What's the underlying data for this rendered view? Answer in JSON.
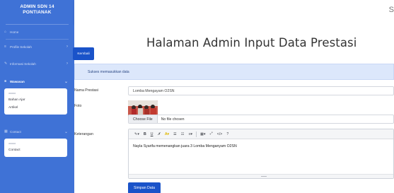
{
  "sidebar": {
    "brand_line1": "ADMIN SDN 14",
    "brand_line2": "PONTIANAK",
    "items": [
      {
        "label": "Home",
        "icon": "home-icon"
      },
      {
        "label": "Profile Sekolah",
        "icon": "list-icon"
      },
      {
        "label": "Informasi Sekolah",
        "icon": "wrench-icon"
      },
      {
        "label": "Wawasan",
        "icon": "folder-icon"
      },
      {
        "label": "Contact",
        "icon": "table-icon"
      }
    ],
    "wawasan_sub": {
      "heading": "aaaaa",
      "items": [
        "Bahan Ajar",
        "Artikel"
      ]
    },
    "contact_sub": {
      "heading": "aaaaa",
      "items": [
        "Contact"
      ]
    }
  },
  "topbar": {
    "user_initial": "S"
  },
  "main": {
    "title": "Halaman Admin Input Data Prestasi",
    "back_label": "Kembali",
    "alert_text": "Sukses memasukkan data",
    "fields": {
      "nama_label": "Nama Prestasi",
      "nama_value": "Lomba Mengayam O2SN",
      "foto_label": "Foto",
      "choose_file": "Choose File",
      "no_file": "No file chosen",
      "keterangan_label": "Keterangan",
      "keterangan_value": "Nayla Syarifa memenangkan juara 3 Lomba Menganyam O2SN"
    },
    "submit_label": "Simpan Data"
  },
  "colors": {
    "sidebar": "#3f72d6",
    "button": "#1a53c9",
    "alert_bg": "#dce7fb"
  }
}
